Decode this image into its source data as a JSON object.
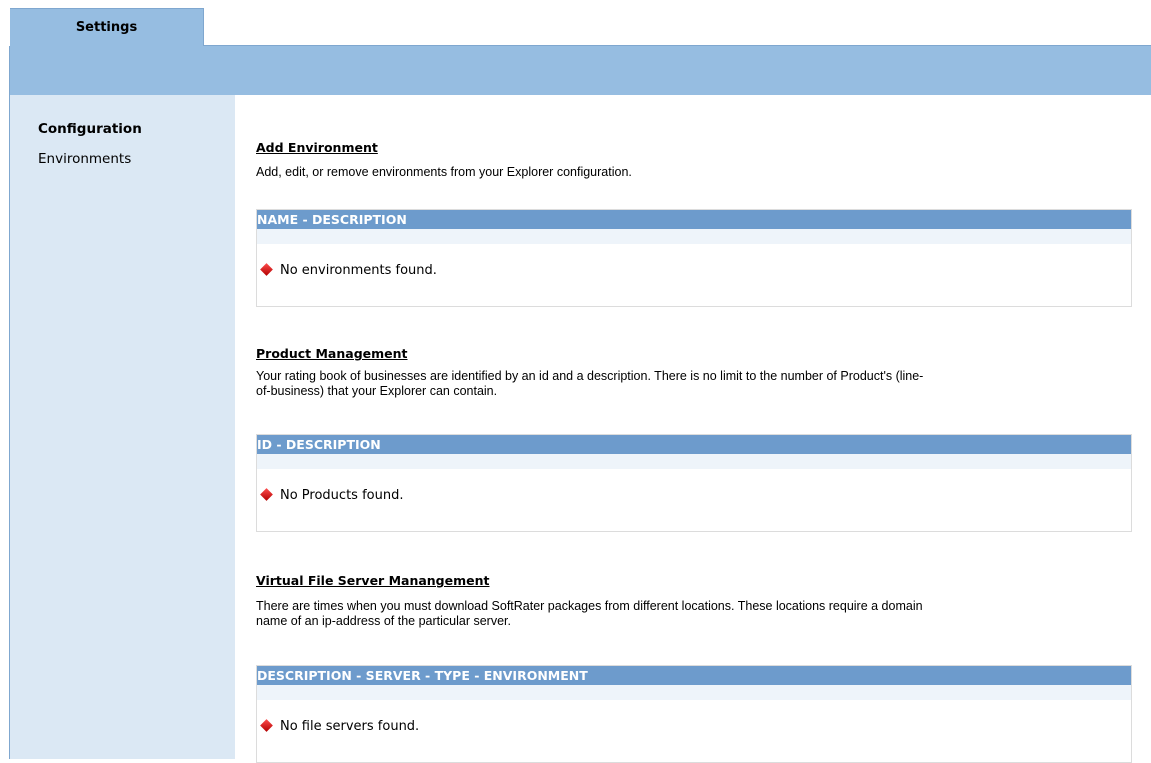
{
  "tabs": [
    {
      "label": "Settings",
      "active": true
    }
  ],
  "sidebar": {
    "items": [
      {
        "label": "Configuration",
        "active": true
      },
      {
        "label": "Environments",
        "active": false
      }
    ]
  },
  "sections": [
    {
      "title": "Add Environment",
      "description": "Add, edit, or remove environments from your Explorer configuration.",
      "table_header": "NAME - DESCRIPTION",
      "empty_message": "No environments found."
    },
    {
      "title": "Product Management",
      "description_lines": [
        "Your rating book of businesses are identified by an id and a description. There is no limit to the number of Product's (line-",
        "of-business) that your Explorer can contain."
      ],
      "table_header": "ID - DESCRIPTION",
      "empty_message": "No Products found."
    },
    {
      "title": "Virtual File Server Manangement",
      "description_lines": [
        "There are times when you must download SoftRater packages from different locations. These locations require a domain",
        "name of an ip-address of the particular server."
      ],
      "table_header": "DESCRIPTION - SERVER - TYPE - ENVIRONMENT",
      "empty_message": "No file servers found."
    }
  ],
  "icons": {
    "empty_state": "red-diamond-icon"
  },
  "colors": {
    "tab_band": "#96bde1",
    "sidebar": "#dbe8f4",
    "table_header": "#6d9bcc",
    "table_subband": "#eef4fa",
    "empty_icon": "#c00000"
  }
}
